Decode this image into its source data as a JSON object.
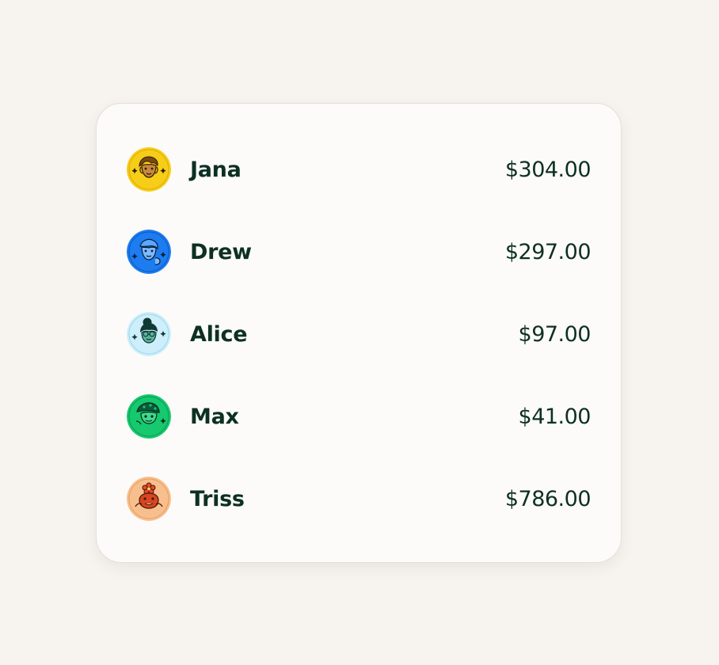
{
  "users": [
    {
      "name": "Jana",
      "amount": "$304.00",
      "avatar_icon": "woman-curly-hair-avatar-icon",
      "avatar_color": "#f6cd18"
    },
    {
      "name": "Drew",
      "amount": "$297.00",
      "avatar_icon": "man-waving-avatar-icon",
      "avatar_color": "#1c7cf0"
    },
    {
      "name": "Alice",
      "amount": "$97.00",
      "avatar_icon": "woman-bun-glasses-avatar-icon",
      "avatar_color": "#cdeefa"
    },
    {
      "name": "Max",
      "amount": "$41.00",
      "avatar_icon": "character-cap-avatar-icon",
      "avatar_color": "#16c86e"
    },
    {
      "name": "Triss",
      "amount": "$786.00",
      "avatar_icon": "monster-flower-avatar-icon",
      "avatar_color": "#f8bf8e"
    }
  ],
  "colors": {
    "text": "#0d3024",
    "background": "#f7f4f0",
    "card": "#fcfbfa"
  }
}
